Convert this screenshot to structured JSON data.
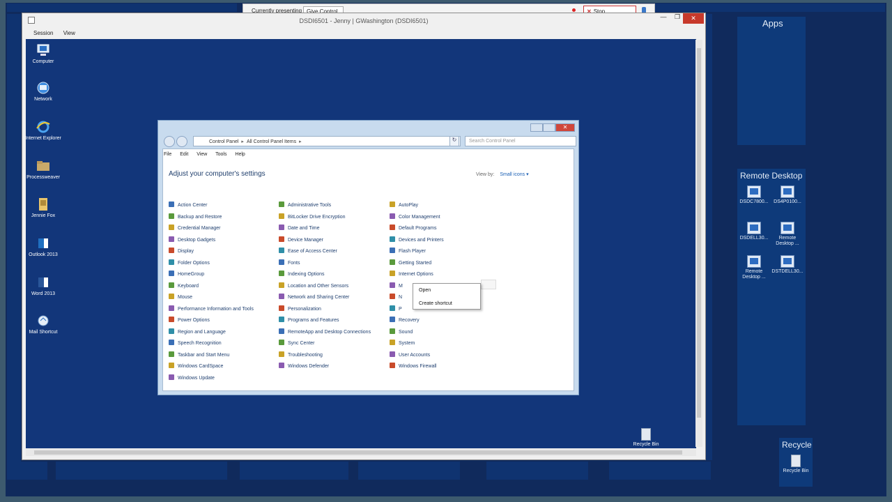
{
  "presenting_bar": {
    "label": "Currently presenting",
    "give_control": "Give Control ▾",
    "stop_presenting": "Stop Presenting",
    "stop_icon": "close-icon",
    "pin_icon": "pin-icon"
  },
  "rdp_window": {
    "title": "DSDI6501 - Jenny | GWashington (DSDI6501)",
    "menu": [
      "Session",
      "View"
    ],
    "buttons": {
      "minimize": "—",
      "restore": "❐",
      "close": "✕"
    }
  },
  "desktop_icons": [
    {
      "label": "Computer",
      "icon": "computer-icon"
    },
    {
      "label": "Network",
      "icon": "network-icon"
    },
    {
      "label": "Internet Explorer",
      "icon": "internet-explorer-icon"
    },
    {
      "label": "Processweaver",
      "icon": "folder-icon"
    },
    {
      "label": "Jennie Fox",
      "icon": "user-folder-icon"
    },
    {
      "label": "Outlook 2013",
      "icon": "outlook-icon"
    },
    {
      "label": "Word 2013",
      "icon": "word-icon"
    },
    {
      "label": "Mail Shortcut",
      "icon": "mail-icon"
    }
  ],
  "control_panel": {
    "breadcrumb": [
      "Control Panel",
      "All Control Panel Items"
    ],
    "search_placeholder": "Search Control Panel",
    "menu": [
      "File",
      "Edit",
      "View",
      "Tools",
      "Help"
    ],
    "heading": "Adjust your computer's settings",
    "view_by_label": "View by:",
    "view_by_value": "Small icons ▾",
    "columns": [
      [
        "Action Center",
        "Backup and Restore",
        "Credential Manager",
        "Desktop Gadgets",
        "Display",
        "Folder Options",
        "HomeGroup",
        "Keyboard",
        "Mouse",
        "Performance Information and Tools",
        "Power Options",
        "Region and Language",
        "Speech Recognition",
        "Taskbar and Start Menu",
        "Windows CardSpace",
        "Windows Update"
      ],
      [
        "Administrative Tools",
        "BitLocker Drive Encryption",
        "Date and Time",
        "Device Manager",
        "Ease of Access Center",
        "Fonts",
        "Indexing Options",
        "Location and Other Sensors",
        "Network and Sharing Center",
        "Personalization",
        "Programs and Features",
        "RemoteApp and Desktop Connections",
        "Sync Center",
        "Troubleshooting",
        "Windows Defender"
      ],
      [
        "AutoPlay",
        "Color Management",
        "Default Programs",
        "Devices and Printers",
        "Flash Player",
        "Getting Started",
        "Internet Options",
        "M",
        "N",
        "P",
        "Recovery",
        "Sound",
        "System",
        "User Accounts",
        "Windows Firewall"
      ]
    ],
    "icon_colors": [
      "#3b6fb6",
      "#5a9a3c",
      "#c9a227",
      "#8a5bb0",
      "#c94b2b",
      "#2f8fa8"
    ]
  },
  "context_menu": {
    "items": [
      "Open",
      "Create shortcut"
    ]
  },
  "inner_recycle": {
    "label": "Recycle Bin"
  },
  "start_screen": {
    "apps_title": "Apps",
    "remote_desktop_title": "Remote Desktop",
    "remote_desktop_items": [
      "DSDC7800...",
      "DS4P0100...",
      "DSDELL30...",
      "Remote Desktop ...",
      "Remote Desktop ...",
      "DSTDELL30..."
    ],
    "recycle_title": "Recycle",
    "recycle_label": "Recycle Bin"
  }
}
